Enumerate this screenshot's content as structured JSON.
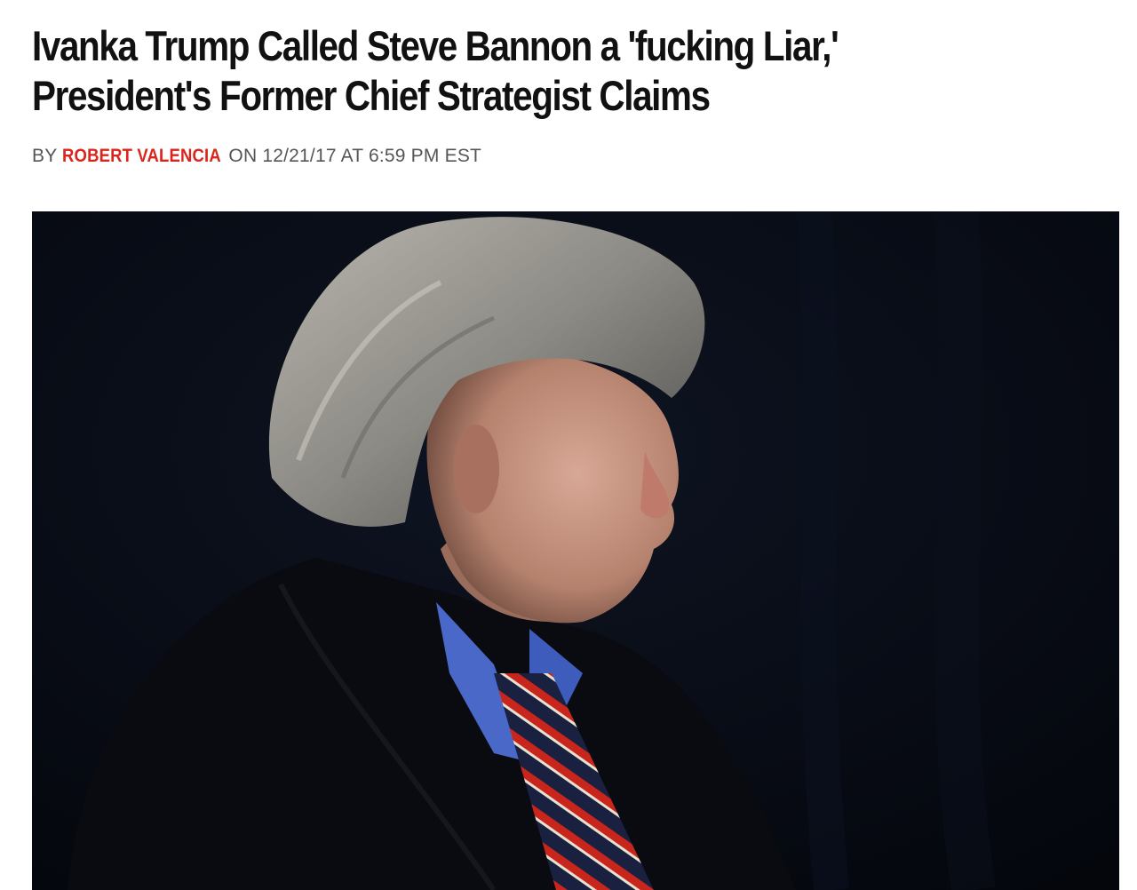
{
  "article": {
    "headline_line1": "Ivanka Trump Called Steve Bannon a 'fucking Liar,'",
    "headline_line2": "President's Former Chief Strategist Claims",
    "byline": {
      "by": "BY",
      "author": "ROBERT VALENCIA",
      "on": "ON",
      "date": "12/21/17",
      "at": "AT",
      "time": "6:59 PM EST"
    },
    "author_color": "#d9261c",
    "hero_image": {
      "subject": "man-in-dark-coat-looking-down",
      "background_color": "#05070d"
    }
  }
}
